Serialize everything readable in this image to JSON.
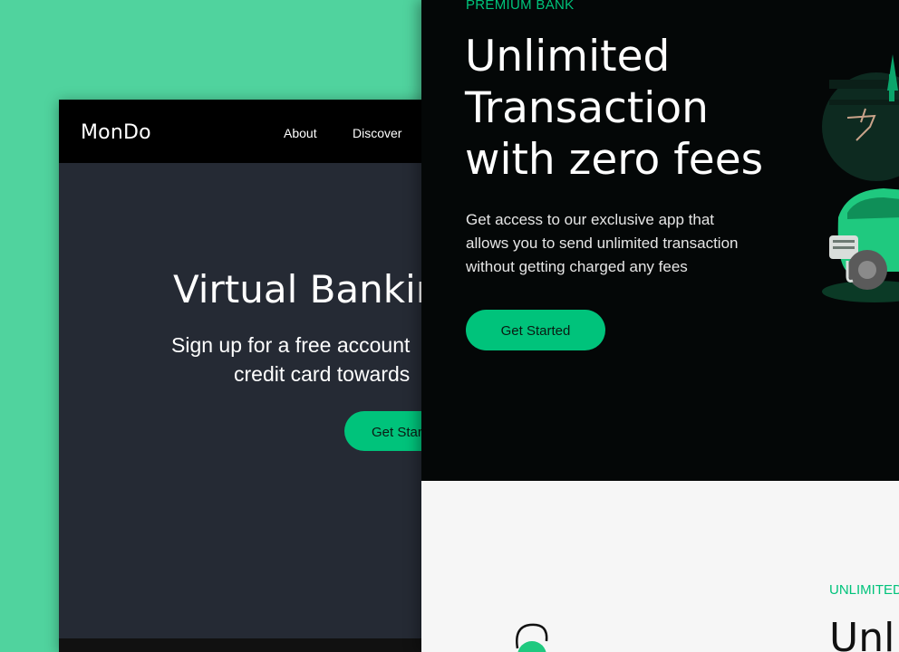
{
  "back_window": {
    "logo": "MonDo",
    "nav": {
      "about": "About",
      "discover": "Discover"
    },
    "hero_title": "Virtual Banking",
    "hero_subtitle_line1": "Sign up for a free account",
    "hero_subtitle_line2": "credit card towards",
    "cta_label": "Get Started"
  },
  "front_window": {
    "eyebrow": "PREMIUM BANK",
    "title_lines": [
      "Unlimited",
      "Transaction",
      "with zero fees"
    ],
    "description_lines": [
      "Get access to our exclusive app that",
      "allows you to send unlimited transaction",
      "without getting charged any fees"
    ],
    "cta_label": "Get Started",
    "section2_eyebrow": "UNLIMITED",
    "section2_title": "Unl"
  },
  "colors": {
    "background": "#50d39e",
    "accent": "#00c37b",
    "hero_bg": "#040707",
    "back_bg": "#252a34"
  },
  "icons": {
    "illustration": "car-illustration",
    "section_icon": "card-illustration"
  }
}
